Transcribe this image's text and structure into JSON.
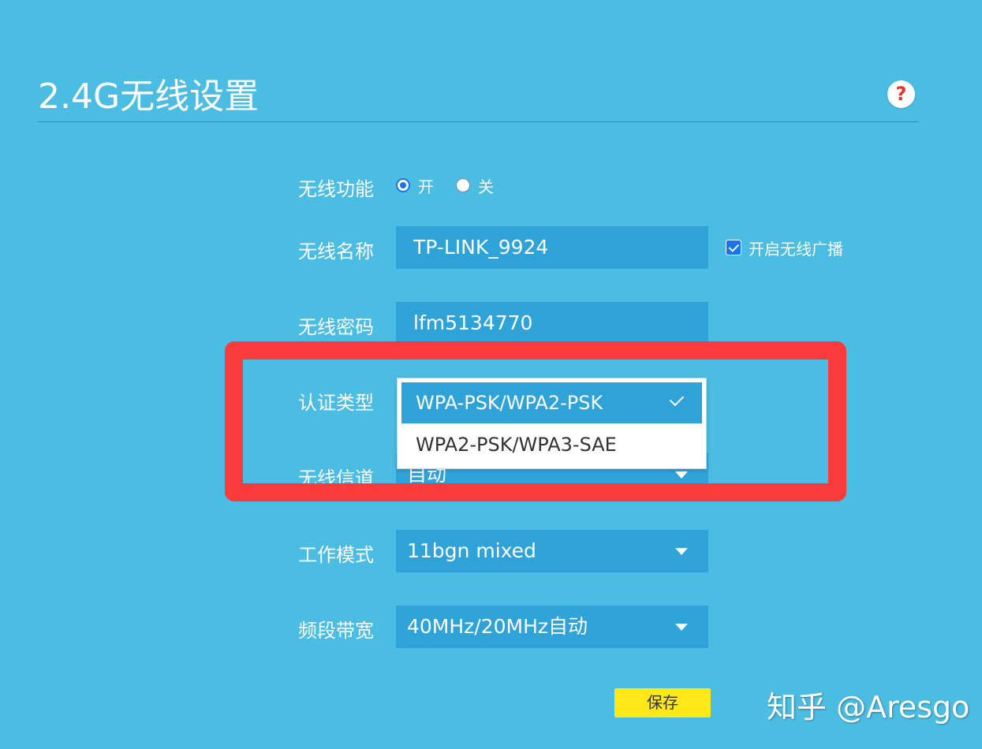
{
  "page": {
    "title": "2.4G无线设置",
    "help_icon": "help-icon",
    "help_symbol": "?"
  },
  "form": {
    "wireless_function": {
      "label": "无线功能",
      "options": [
        {
          "label": "开",
          "checked": true
        },
        {
          "label": "关",
          "checked": false
        }
      ]
    },
    "ssid": {
      "label": "无线名称",
      "value": "TP-LINK_9924",
      "broadcast_label": "开启无线广播",
      "broadcast_checked": true
    },
    "password": {
      "label": "无线密码",
      "value": "lfm5134770"
    },
    "auth_type": {
      "label": "认证类型",
      "options": [
        {
          "label": "WPA-PSK/WPA2-PSK",
          "selected": true
        },
        {
          "label": "WPA2-PSK/WPA3-SAE",
          "selected": false
        }
      ]
    },
    "channel": {
      "label": "无线信道",
      "value": "自动"
    },
    "mode": {
      "label": "工作模式",
      "value": "11bgn mixed"
    },
    "bandwidth": {
      "label": "频段带宽",
      "value": "40MHz/20MHz自动"
    }
  },
  "actions": {
    "save_label": "保存"
  },
  "watermark": {
    "text": "知乎 @Aresgo"
  },
  "colors": {
    "background": "#4bbde2",
    "field": "#2fa3d8",
    "highlight": "#fa3b3b",
    "save_button": "#ffe81a",
    "accent": "#1a73e8"
  }
}
